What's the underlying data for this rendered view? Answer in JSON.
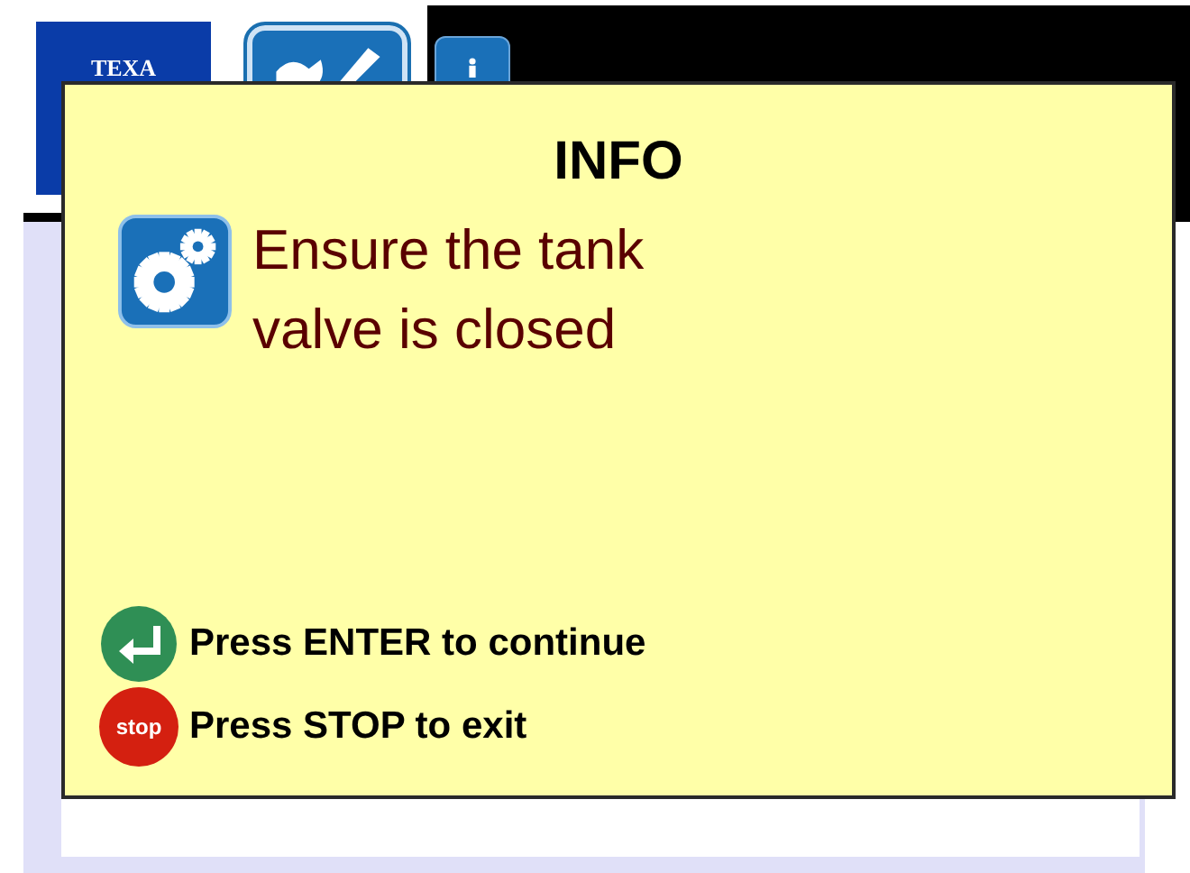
{
  "header": {
    "logo": "TEXA"
  },
  "dialog": {
    "title": "INFO",
    "message_lines": [
      "Ensure the tank",
      "valve is closed"
    ],
    "actions": [
      {
        "kind": "enter",
        "label": "Press ENTER to continue"
      },
      {
        "kind": "stop",
        "icon_text": "stop",
        "label": "Press STOP to exit"
      }
    ]
  }
}
